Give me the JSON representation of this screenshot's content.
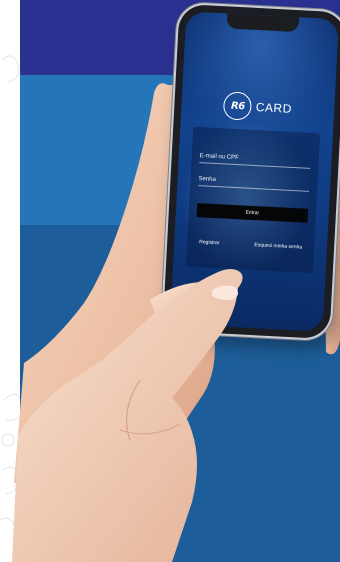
{
  "app": {
    "logo_mark": "R6",
    "brand_name": "CARD"
  },
  "login": {
    "email_placeholder": "E-mail ou CPF",
    "password_placeholder": "Senha",
    "submit_label": "Entrar",
    "register_link": "Registrar",
    "forgot_link": "Esqueci minha senha"
  },
  "colors": {
    "band_top": "#2b3190",
    "band_mid": "#2576b9",
    "band_bottom": "#1d5e9a",
    "screen_bg": "#12438e",
    "button_bg": "#050608"
  },
  "icons": [
    "r6-logo-icon",
    "hand-holding-phone",
    "pointing-finger"
  ]
}
